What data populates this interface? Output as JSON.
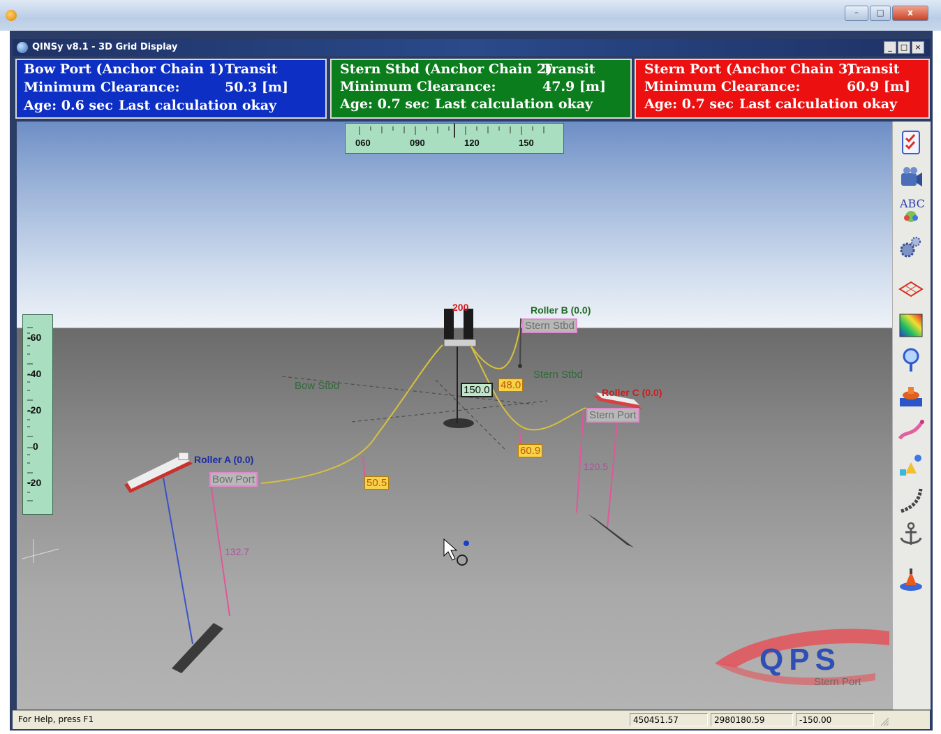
{
  "host_window": {
    "buttons": {
      "minimize": "–",
      "maximize": "□",
      "close": "x"
    }
  },
  "app": {
    "title": "QINSy v8.1 - 3D Grid Display",
    "window_controls": {
      "minimize": "_",
      "restore": "□",
      "close": "×"
    }
  },
  "panels": [
    {
      "name": "Bow Port (Anchor Chain 1)",
      "mode": "Transit",
      "clearance_label": "Minimum Clearance:",
      "clearance_value": "50.3 [m]",
      "age": "Age: 0.6 sec",
      "status": "Last calculation okay",
      "color": "#0d2fc4"
    },
    {
      "name": "Stern Stbd (Anchor Chain 2)",
      "mode": "Transit",
      "clearance_label": "Minimum Clearance:",
      "clearance_value": "47.9 [m]",
      "age": "Age: 0.7 sec",
      "status": "Last calculation okay",
      "color": "#0b7d1d"
    },
    {
      "name": "Stern Port (Anchor Chain 3)",
      "mode": "Transit",
      "clearance_label": "Minimum Clearance:",
      "clearance_value": "60.9 [m]",
      "age": "Age: 0.7 sec",
      "status": "Last calculation okay",
      "color": "#ec1010"
    }
  ],
  "compass": {
    "ticks": [
      "060",
      "090",
      "120",
      "150"
    ]
  },
  "depth_scale": {
    "ticks": [
      "-60",
      "-40",
      "-20",
      "0",
      "-20"
    ]
  },
  "scene": {
    "roller_a": "Roller A (0.0)",
    "roller_b": "Roller B (0.0)",
    "roller_c": "Roller C (0.0)",
    "tag_bow_port": "Bow Port",
    "tag_stern_stbd": "Stern Stbd",
    "tag_stern_port": "Stern Port",
    "label_bow_stbd": "Bow Stbd",
    "label_stern_stbd": "Stern Stbd",
    "label_rig_top": "200",
    "box_150": "150.0",
    "box_48": "48.0",
    "box_60_9": "60.9",
    "box_50_5": "50.5",
    "depth_132_7": "132.7",
    "depth_120_5": "120.5",
    "logo": "QPS",
    "logo_caption": "Stern Port"
  },
  "toolbar": {
    "tools": [
      "checklist-icon",
      "camera-icon",
      "labels-abc-icon",
      "settings-gears-icon",
      "grid-layers-icon",
      "color-palette-icon",
      "magnifier-icon",
      "vessel-icon",
      "route-line-icon",
      "shapes-icon",
      "chain-icon",
      "anchor-icon",
      "buoy-icon"
    ],
    "abc_text": "ABC"
  },
  "statusbar": {
    "help": "For Help, press F1",
    "easting": "450451.57",
    "northing": "2980180.59",
    "height": "-150.00"
  }
}
